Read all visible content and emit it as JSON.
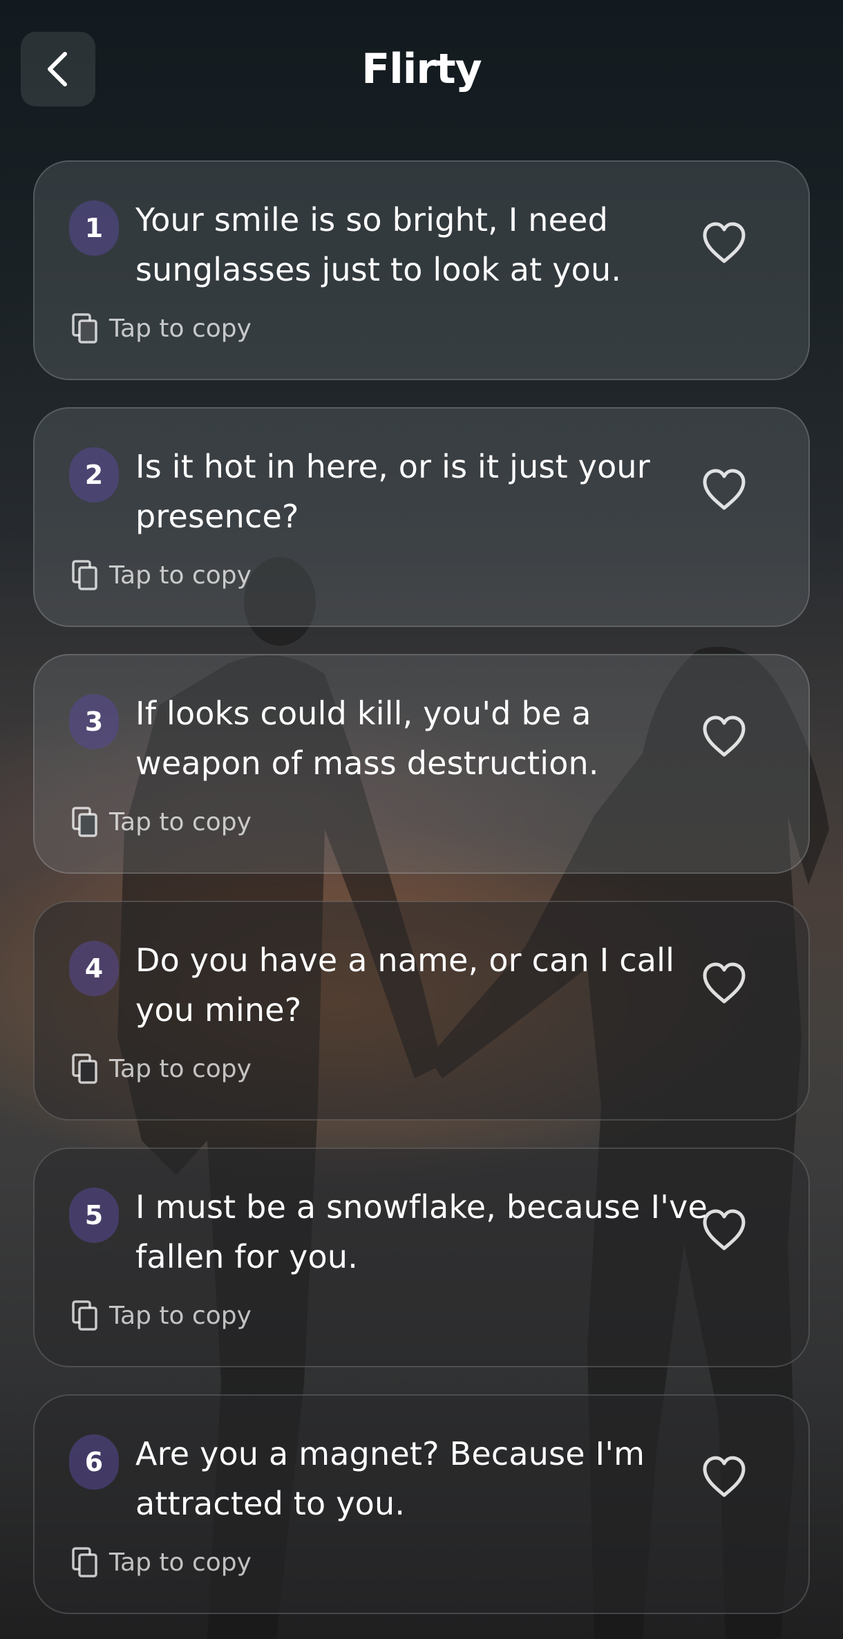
{
  "header": {
    "title": "Flirty",
    "back_icon": "chevron-left-icon"
  },
  "card_actions": {
    "copy_icon": "copy-icon",
    "favorite_icon": "heart-outline-icon"
  },
  "lines": [
    {
      "number": "1",
      "text": "Your smile is so bright, I need sunglasses just to look at you.",
      "copy_label": "Tap to copy"
    },
    {
      "number": "2",
      "text": "Is it hot in here, or is it just your presence?",
      "copy_label": "Tap to copy"
    },
    {
      "number": "3",
      "text": "If looks could kill, you'd be a weapon of mass destruction.",
      "copy_label": "Tap to copy"
    },
    {
      "number": "4",
      "text": "Do you have a name, or can I call you mine?",
      "copy_label": "Tap to copy"
    },
    {
      "number": "5",
      "text": "I must be a snowflake, because I've fallen for you.",
      "copy_label": "Tap to copy"
    },
    {
      "number": "6",
      "text": "Are you a magnet? Because I'm attracted to you.",
      "copy_label": "Tap to copy"
    }
  ]
}
